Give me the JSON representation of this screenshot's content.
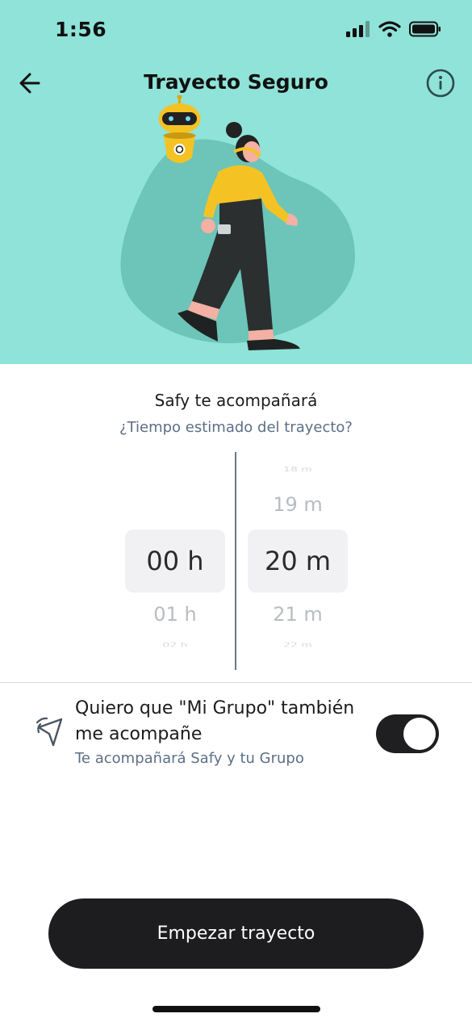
{
  "status_bar": {
    "time": "1:56"
  },
  "nav": {
    "title": "Trayecto Seguro"
  },
  "content": {
    "heading": "Safy te acompañará",
    "subheading": "¿Tiempo estimado del trayecto?"
  },
  "picker": {
    "hours": {
      "above_far": "",
      "above_near": "",
      "selected": "00 h",
      "below_near": "01 h",
      "below_far": "02 h"
    },
    "minutes": {
      "above_far": "18 m",
      "above_near": "19 m",
      "selected": "20 m",
      "below_near": "21 m",
      "below_far": "22 m"
    }
  },
  "group_option": {
    "title": "Quiero que \"Mi Grupo\" también me acompañe",
    "subtitle": "Te acompañará Safy y tu Grupo",
    "enabled": true
  },
  "start_button": {
    "label": "Empezar trayecto"
  },
  "colors": {
    "hero": "#8fe3d8",
    "blob": "#6cc5b8",
    "accent_yellow": "#f5c224",
    "dark": "#1d1d20",
    "muted": "#5d6f86"
  }
}
